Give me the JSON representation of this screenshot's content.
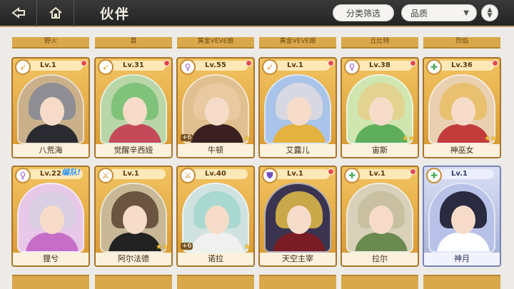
{
  "header": {
    "title": "伙伴",
    "filter_label": "分类筛选",
    "quality_label": "品质",
    "quality_arrow": "▼"
  },
  "partial_row": [
    "野火",
    "莫",
    "黄金VEVE娘",
    "黄金VEVE娘",
    "丘比特",
    "烈焰"
  ],
  "cards": [
    {
      "level": "Lv.1",
      "name": "八荒海",
      "class": "archer",
      "hair": "#8e8e94",
      "outfit": "#2a2a30",
      "bg": "#c9b08a",
      "stars": "",
      "plus": "",
      "dot": true,
      "team": ""
    },
    {
      "level": "Lv.31",
      "name": "觉醒辛西娅",
      "class": "archer",
      "hair": "#7fc27a",
      "outfit": "#c44a5a",
      "bg": "#b8d6a8",
      "stars": "",
      "plus": "",
      "dot": true,
      "team": ""
    },
    {
      "level": "Lv.55",
      "name": "牛顿",
      "class": "mage",
      "hair": "#e8c9a0",
      "outfit": "#3a2020",
      "bg": "#e0c090",
      "stars": "★",
      "plus": "+6",
      "dot": true,
      "team": ""
    },
    {
      "level": "Lv.1",
      "name": "艾露儿",
      "class": "archer",
      "hair": "#d8d8e2",
      "outfit": "#e3b240",
      "bg": "#a9c4e8",
      "stars": "",
      "plus": "",
      "dot": true,
      "team": ""
    },
    {
      "level": "Lv.38",
      "name": "宙斯",
      "class": "mage",
      "hair": "#e2d390",
      "outfit": "#5fae5c",
      "bg": "#cfe6b0",
      "stars": "★★",
      "plus": "",
      "dot": true,
      "team": ""
    },
    {
      "level": "Lv.36",
      "name": "神巫女",
      "class": "healer",
      "hair": "#e8c070",
      "outfit": "#c33c3c",
      "bg": "#e8d0b0",
      "stars": "★★",
      "plus": "",
      "dot": true,
      "team": ""
    },
    {
      "level": "Lv.22",
      "name": "狸兮",
      "class": "mage",
      "hair": "#d9cfe3",
      "outfit": "#c66ec7",
      "bg": "#e8c8e8",
      "stars": "",
      "plus": "",
      "dot": false,
      "team": "编队!"
    },
    {
      "level": "Lv.1",
      "name": "阿尔法德",
      "class": "warrior",
      "hair": "#6b5540",
      "outfit": "#222222",
      "bg": "#c8b896",
      "stars": "★★",
      "plus": "",
      "dot": false,
      "team": ""
    },
    {
      "level": "Lv.40",
      "name": "诺拉",
      "class": "warrior",
      "hair": "#a8d8d0",
      "outfit": "#f0f0f0",
      "bg": "#cfe2df",
      "stars": "★",
      "plus": "+6",
      "dot": false,
      "team": ""
    },
    {
      "level": "Lv.1",
      "name": "天空主宰",
      "class": "tank",
      "hair": "#c9a84a",
      "outfit": "#7a1c24",
      "bg": "#3a3450",
      "stars": "",
      "plus": "",
      "dot": true,
      "team": ""
    },
    {
      "level": "Lv.1",
      "name": "拉尔",
      "class": "healer",
      "hair": "#c8c0a0",
      "outfit": "#6a8a50",
      "bg": "#d8d0b8",
      "stars": "",
      "plus": "",
      "dot": true,
      "team": ""
    },
    {
      "level": "Lv.1",
      "name": "神月",
      "class": "healer",
      "hair": "#2a2a40",
      "outfit": "#ffffff",
      "bg": "#b8c2e8",
      "stars": "",
      "plus": "",
      "dot": false,
      "team": "",
      "silver": true
    }
  ],
  "class_icons": {
    "archer": {
      "glyph": "➶",
      "color": "#e39b2b"
    },
    "mage": {
      "glyph": "♀",
      "color": "#a05ad0"
    },
    "healer": {
      "glyph": "✚",
      "color": "#45a85a"
    },
    "warrior": {
      "glyph": "⚔",
      "color": "#d98a2a"
    },
    "tank": {
      "glyph": "⛊",
      "color": "#7050c0"
    }
  },
  "colors": {
    "header_bg": "#2c2c2c",
    "gold_card": "#e6ae48",
    "silver_card": "#b9c2e6",
    "accent": "#b9a06a"
  }
}
